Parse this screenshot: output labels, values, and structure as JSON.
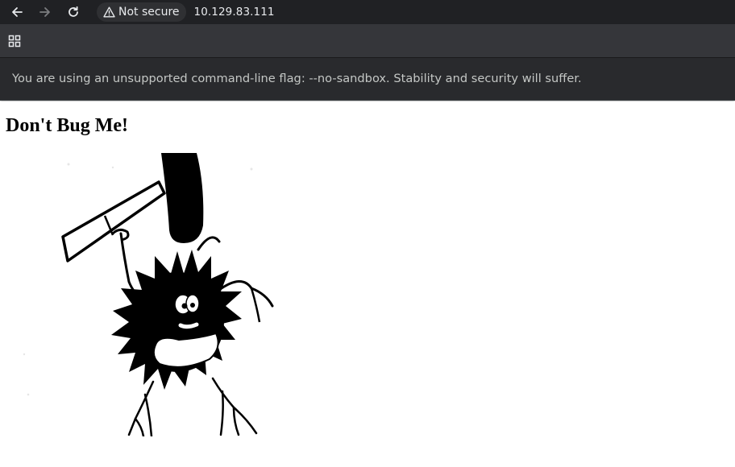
{
  "browser": {
    "security_label": "Not secure",
    "url": "10.129.83.111",
    "icons": {
      "back": "arrow-left-icon",
      "forward": "arrow-right-icon",
      "reload": "reload-icon",
      "security": "warning-triangle-icon",
      "apps": "apps-grid-icon"
    },
    "forward_enabled": false
  },
  "infobar": {
    "message": "You are using an unsupported command-line flag: --no-sandbox. Stability and security will suffer."
  },
  "page": {
    "heading": "Don't Bug Me!",
    "image_subject": "cartoon fuzzy bug holding a flyswatter"
  },
  "colors": {
    "toolbar": "#202124",
    "bookmarks_bar": "#35363a",
    "infobar": "#292a2d",
    "page_background": "#ffffff"
  }
}
